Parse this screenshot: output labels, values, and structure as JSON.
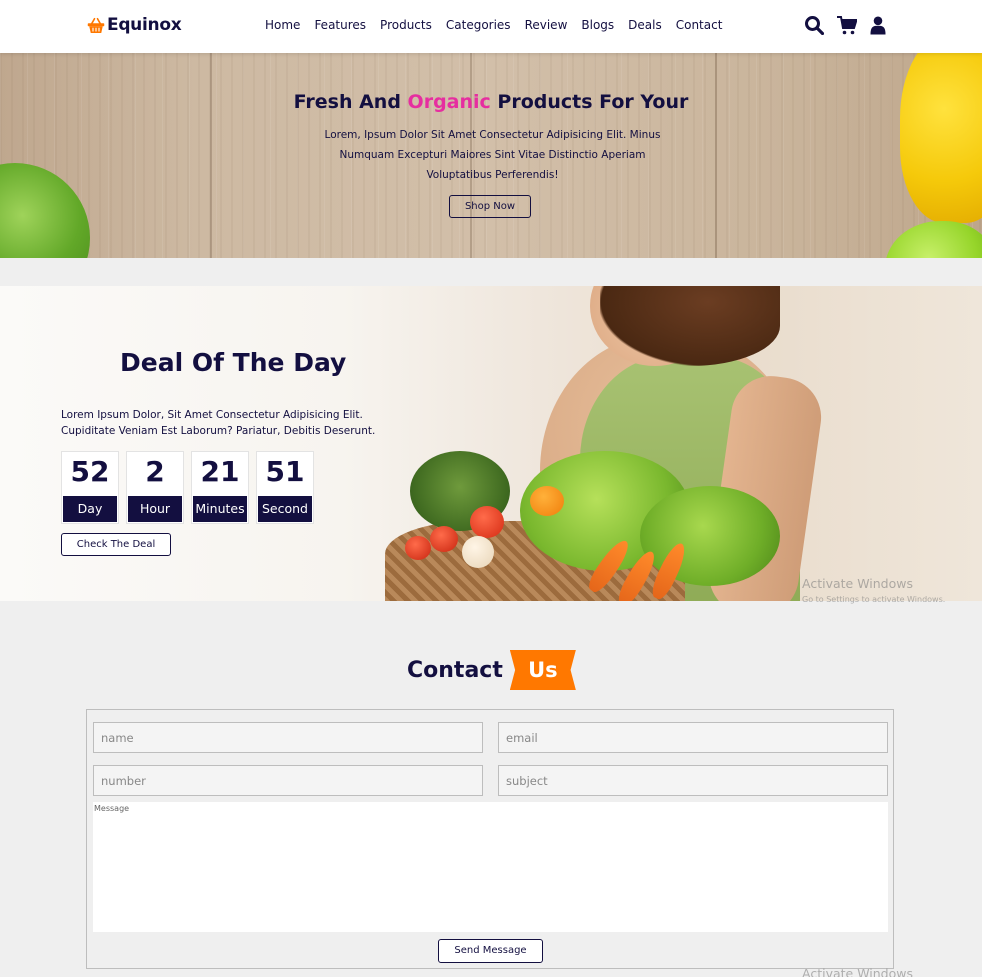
{
  "header": {
    "logo_text": "Equinox",
    "nav": [
      "Home",
      "Features",
      "Products",
      "Categories",
      "Review",
      "Blogs",
      "Deals",
      "Contact"
    ],
    "icons": [
      "search-icon",
      "cart-icon",
      "user-icon"
    ]
  },
  "banner": {
    "title_part1": "Fresh And ",
    "title_highlight": "Organic",
    "title_part2": " Products For Your",
    "description": "Lorem, Ipsum Dolor Sit Amet Consectetur Adipisicing Elit. Minus Numquam Excepturi Maiores Sint Vitae Distinctio Aperiam Voluptatibus Perferendis!",
    "button": "Shop Now"
  },
  "deal": {
    "title": "Deal Of The Day",
    "description": "Lorem Ipsum Dolor, Sit Amet Consectetur Adipisicing Elit. Cupiditate Veniam Est Laborum? Pariatur, Debitis Deserunt.",
    "countdown": [
      {
        "value": "52",
        "label": "Day"
      },
      {
        "value": "2",
        "label": "Hour"
      },
      {
        "value": "21",
        "label": "Minutes"
      },
      {
        "value": "51",
        "label": "Second"
      }
    ],
    "button": "Check The Deal"
  },
  "contact": {
    "title": "Contact",
    "title_highlight": "Us",
    "name_placeholder": "name",
    "email_placeholder": "email",
    "number_placeholder": "number",
    "subject_placeholder": "subject",
    "message_placeholder": "Message",
    "button": "Send Message"
  },
  "watermark": {
    "line1": "Activate Windows",
    "line2": "Go to Settings to activate Windows."
  },
  "colors": {
    "primary": "#130f40",
    "accent_orange": "#ff7800",
    "accent_pink": "#e62ea0"
  }
}
